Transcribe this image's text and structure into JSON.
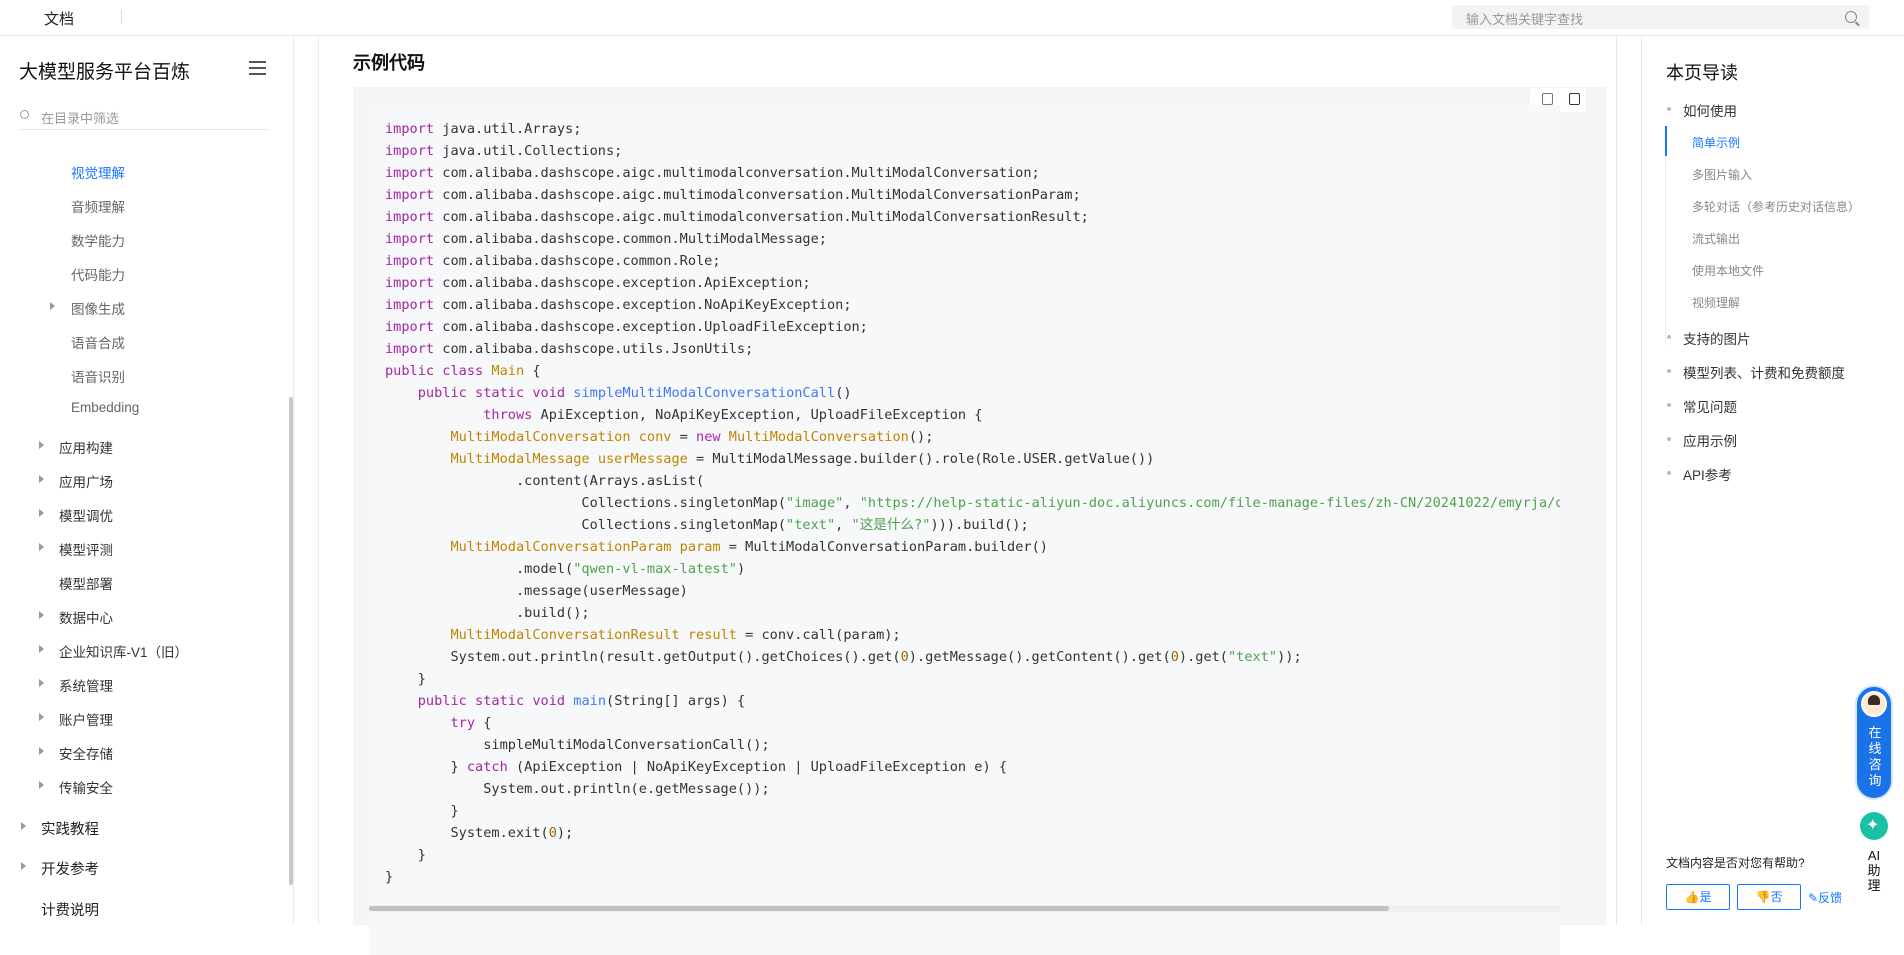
{
  "topbar": {
    "brand": "文档",
    "search_placeholder": "输入文档关键字查找"
  },
  "sidebar": {
    "title": "大模型服务平台百炼",
    "filter_placeholder": "在目录中筛选",
    "items": [
      {
        "label": "视觉理解"
      },
      {
        "label": "音频理解"
      },
      {
        "label": "数学能力"
      },
      {
        "label": "代码能力"
      },
      {
        "label": "图像生成"
      },
      {
        "label": "语音合成"
      },
      {
        "label": "语音识别"
      },
      {
        "label": "Embedding"
      },
      {
        "label": "应用构建"
      },
      {
        "label": "应用广场"
      },
      {
        "label": "模型调优"
      },
      {
        "label": "模型评测"
      },
      {
        "label": "模型部署"
      },
      {
        "label": "数据中心"
      },
      {
        "label": "企业知识库-V1（旧）"
      },
      {
        "label": "系统管理"
      },
      {
        "label": "账户管理"
      },
      {
        "label": "安全存储"
      },
      {
        "label": "传输安全"
      },
      {
        "label": "实践教程"
      },
      {
        "label": "开发参考"
      },
      {
        "label": "计费说明"
      }
    ]
  },
  "main": {
    "section_title": "示例代码",
    "code_language": "java"
  },
  "toc": {
    "title": "本页导读",
    "items": [
      {
        "label": "如何使用"
      },
      {
        "label": "简单示例"
      },
      {
        "label": "多图片输入"
      },
      {
        "label": "多轮对话（参考历史对话信息）"
      },
      {
        "label": "流式输出"
      },
      {
        "label": "使用本地文件"
      },
      {
        "label": "视频理解"
      },
      {
        "label": "支持的图片"
      },
      {
        "label": "模型列表、计费和免费额度"
      },
      {
        "label": "常见问题"
      },
      {
        "label": "应用示例"
      },
      {
        "label": "API参考"
      }
    ]
  },
  "feedback": {
    "question": "文档内容是否对您有帮助?",
    "yes": "是",
    "no": "否",
    "report": "反馈"
  },
  "floating": {
    "consult": "在线咨询",
    "ai": "AI助理"
  },
  "colors": {
    "accent": "#1677ff",
    "keyword": "#a626a4",
    "type": "#c18401",
    "function": "#4078f2",
    "string": "#50a14f"
  }
}
